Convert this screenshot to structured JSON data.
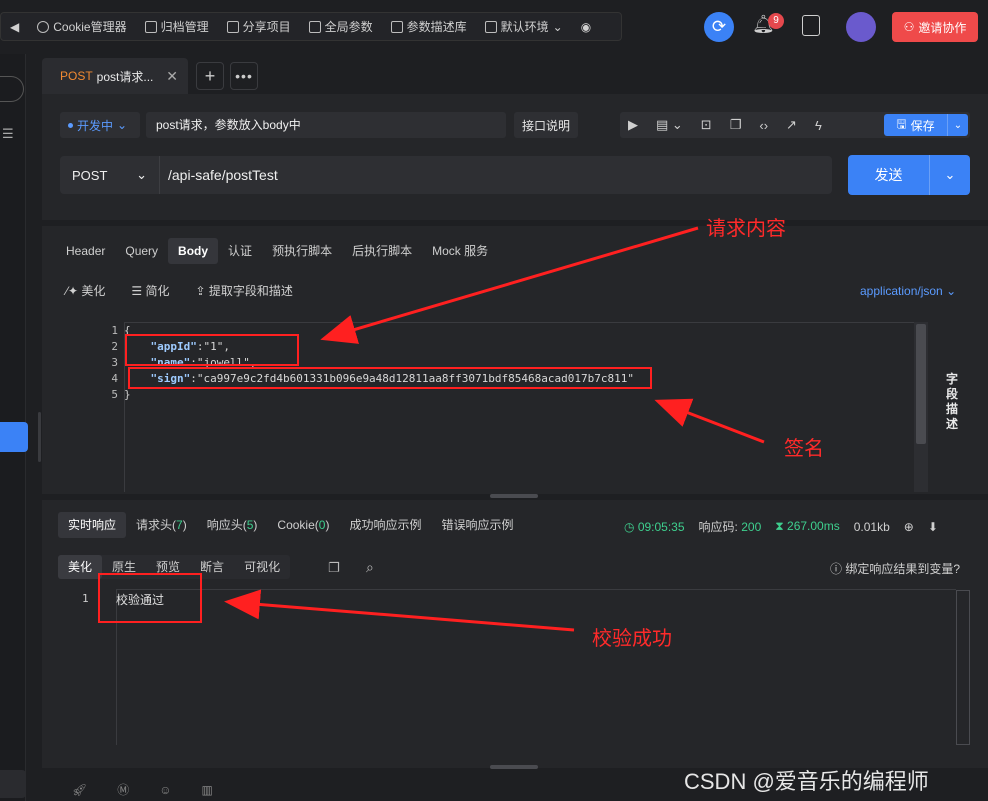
{
  "toolbar": {
    "items": [
      {
        "label": "Cookie管理器",
        "icon": "cookie-icon"
      },
      {
        "label": "归档管理",
        "icon": "archive-icon"
      },
      {
        "label": "分享项目",
        "icon": "share-icon"
      },
      {
        "label": "全局参数",
        "icon": "params-icon"
      },
      {
        "label": "参数描述库",
        "icon": "cube-icon"
      },
      {
        "label": "默认环境",
        "icon": "env-icon"
      }
    ]
  },
  "header": {
    "notification_count": "9",
    "invite_label": "邀请协作"
  },
  "tab": {
    "method": "POST",
    "name": "post请求..."
  },
  "request": {
    "status": "开发中",
    "name": "post请求，参数放入body中",
    "doc_button": "接口说明",
    "save_label": "保存",
    "method": "POST",
    "url": "/api-safe/postTest",
    "send_label": "发送"
  },
  "request_tabs": [
    {
      "label": "Header"
    },
    {
      "label": "Query"
    },
    {
      "label": "Body"
    },
    {
      "label": "认证"
    },
    {
      "label": "预执行脚本"
    },
    {
      "label": "后执行脚本"
    },
    {
      "label": "Mock 服务"
    }
  ],
  "body_tools": {
    "beautify": "美化",
    "simplify": "简化",
    "extract": "提取字段和描述",
    "content_type": "application/json"
  },
  "code": {
    "line_numbers": [
      "1",
      "2",
      "3",
      "4",
      "5"
    ],
    "open": "{",
    "close": "}",
    "appId_key": "\"appId\"",
    "appId_val": "\"1\"",
    "name_key": "\"name\"",
    "name_val": "\"jowell\"",
    "sign_key": "\"sign\"",
    "sign_val": "\"ca997e9c2fd4b601331b096e9a48d12811aa8ff3071bdf85468acad017b7c811\""
  },
  "field_desc": "字段描述",
  "response_tabs": [
    {
      "label": "实时响应",
      "count": ""
    },
    {
      "label": "请求头",
      "count": "7"
    },
    {
      "label": "响应头",
      "count": "5"
    },
    {
      "label": "Cookie",
      "count": "0"
    },
    {
      "label": "成功响应示例",
      "count": ""
    },
    {
      "label": "错误响应示例",
      "count": ""
    }
  ],
  "response_meta": {
    "time": "09:05:35",
    "code_label": "响应码:",
    "code": "200",
    "duration": "267.00ms",
    "size": "0.01kb"
  },
  "view_tabs": [
    {
      "label": "美化"
    },
    {
      "label": "原生"
    },
    {
      "label": "预览"
    },
    {
      "label": "断言"
    },
    {
      "label": "可视化"
    }
  ],
  "bind_var": "绑定响应结果到变量?",
  "response": {
    "line": "1",
    "text": "校验通过"
  },
  "annotations": {
    "request_content": "请求内容",
    "signature": "签名",
    "verify_success": "校验成功"
  },
  "watermark": "CSDN @爱音乐的编程师",
  "colors": {
    "accent": "#3b82f6",
    "method": "#f28a32",
    "success": "#3ecf8e",
    "danger": "#ef4a4a",
    "annotation": "#ff2020"
  }
}
